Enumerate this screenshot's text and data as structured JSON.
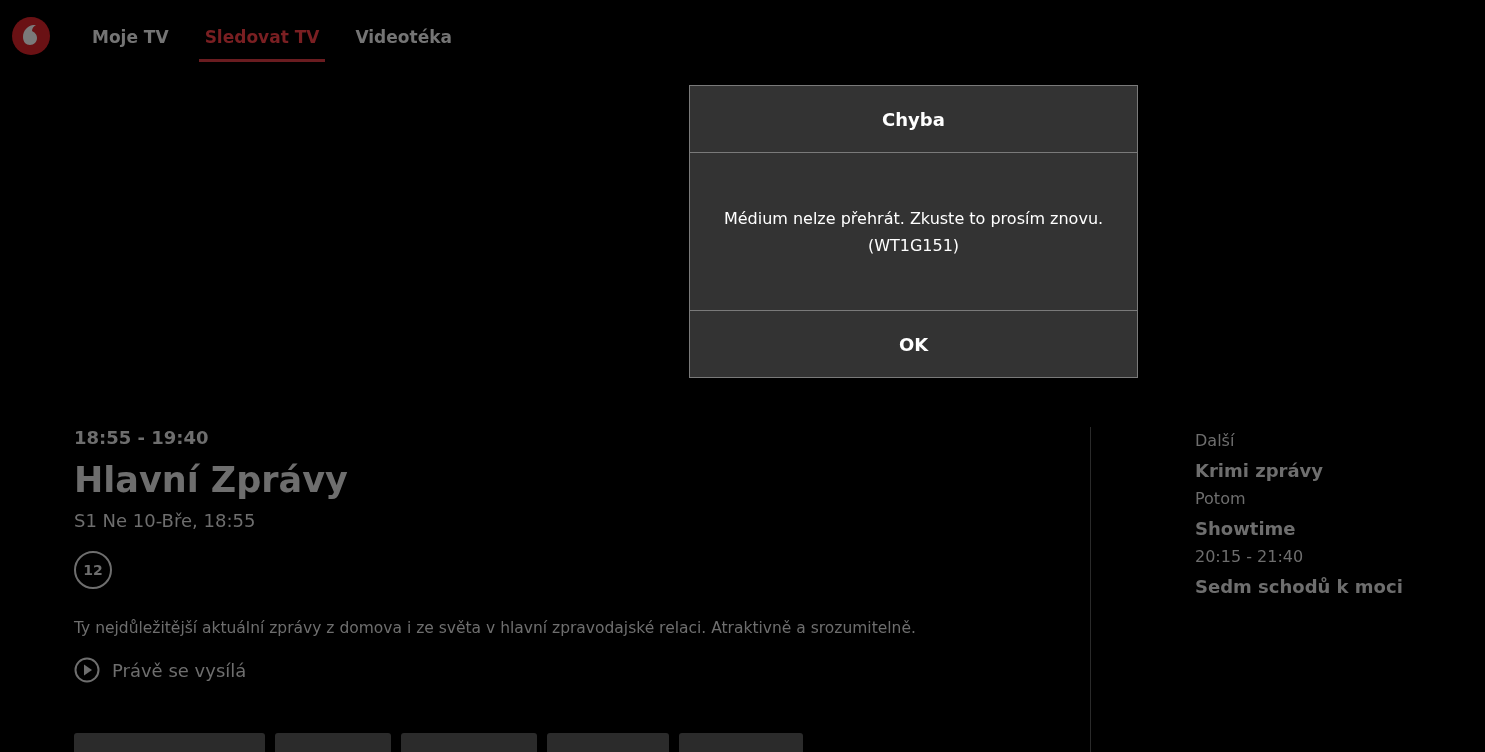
{
  "nav": {
    "tabs": [
      {
        "label": "Moje TV",
        "selected": false
      },
      {
        "label": "Sledovat TV",
        "selected": true
      },
      {
        "label": "Videotéka",
        "selected": false
      }
    ]
  },
  "program": {
    "time": "18:55 - 19:40",
    "title": "Hlavní Zprávy",
    "subtitle": "S1 Ne 10-Bře, 18:55",
    "age_rating": "12",
    "description": "Ty nejdůležitější aktuální zprávy z domova i ze světa v hlavní zpravodajské relaci. Atraktivně a srozumitelně.",
    "status": "Právě se vysílá"
  },
  "up_next": [
    {
      "label": "Další",
      "title": "Krimi zprávy"
    },
    {
      "label": "Potom",
      "title": "Showtime"
    },
    {
      "label": "20:15 - 21:40",
      "title": "Sedm schodů k moci"
    }
  ],
  "dialog": {
    "title": "Chyba",
    "message": "Médium nelze přehrát. Zkuste to prosím znovu.",
    "code": "(WT1G151)",
    "button": "OK"
  }
}
